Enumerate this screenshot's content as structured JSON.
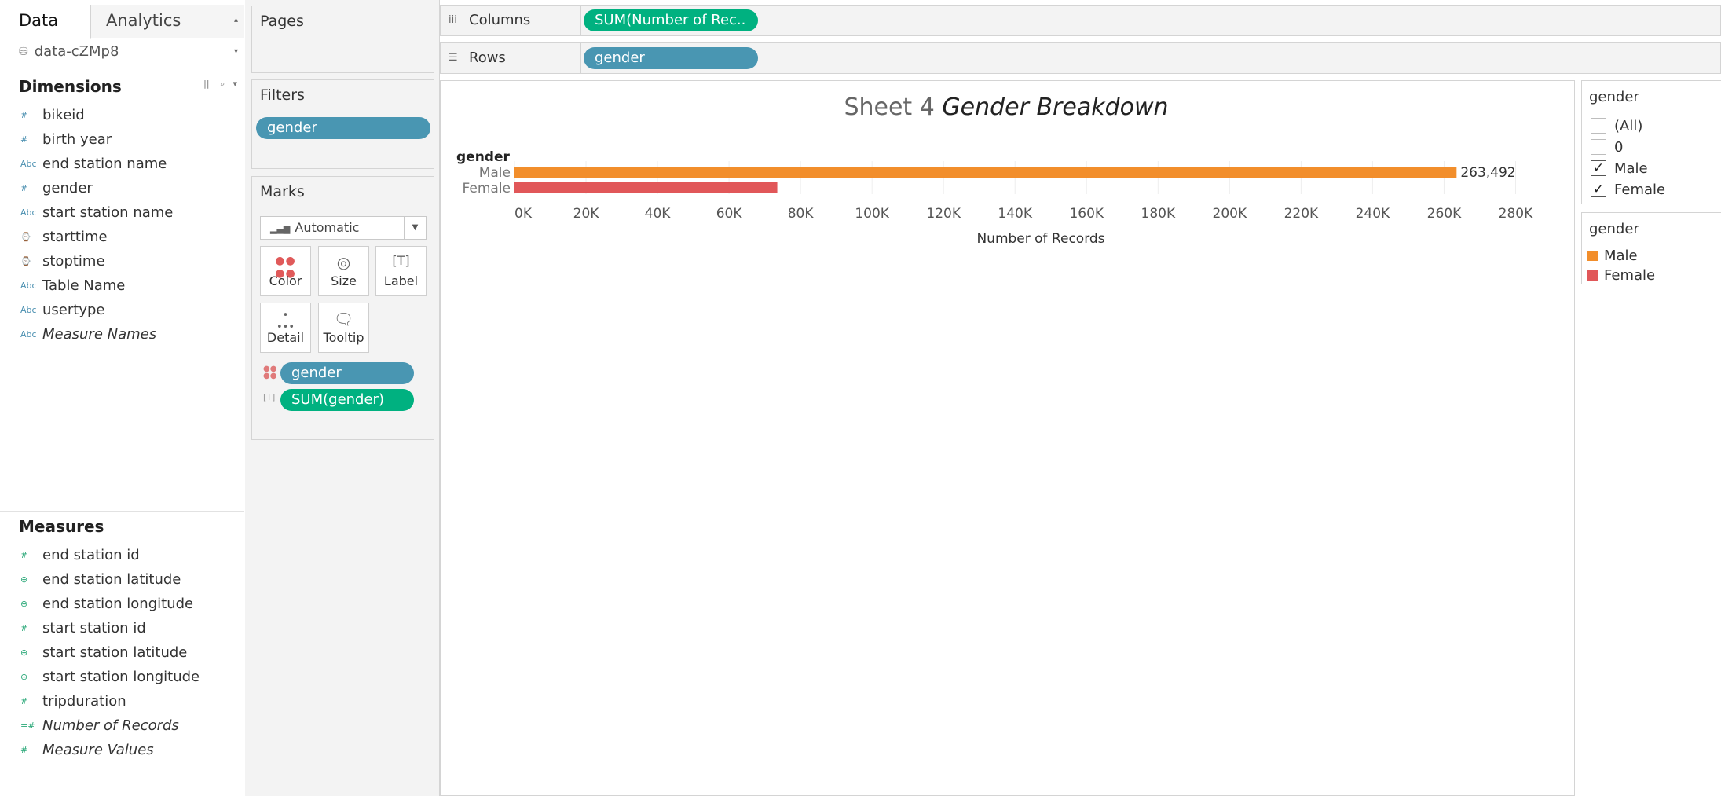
{
  "left_pane": {
    "tabs": [
      {
        "label": "Data"
      },
      {
        "label": "Analytics"
      }
    ],
    "datasource": "data-cZMp8",
    "dimensions_header": "Dimensions",
    "dimensions": [
      {
        "label": "bikeid",
        "icon": "#"
      },
      {
        "label": "birth year",
        "icon": "#"
      },
      {
        "label": "end station name",
        "icon": "Abc"
      },
      {
        "label": "gender",
        "icon": "#"
      },
      {
        "label": "start station name",
        "icon": "Abc"
      },
      {
        "label": "starttime",
        "icon": "date-time-icon"
      },
      {
        "label": "stoptime",
        "icon": "date-time-icon"
      },
      {
        "label": "Table Name",
        "icon": "Abc"
      },
      {
        "label": "usertype",
        "icon": "Abc"
      },
      {
        "label": "Measure Names",
        "icon": "Abc"
      }
    ],
    "measures_header": "Measures",
    "measures": [
      {
        "label": "end station id",
        "icon": "#"
      },
      {
        "label": "end station latitude",
        "icon": "globe-icon"
      },
      {
        "label": "end station longitude",
        "icon": "globe-icon"
      },
      {
        "label": "start station id",
        "icon": "#"
      },
      {
        "label": "start station latitude",
        "icon": "globe-icon"
      },
      {
        "label": "start station longitude",
        "icon": "globe-icon"
      },
      {
        "label": "tripduration",
        "icon": "#"
      },
      {
        "label": "Number of Records",
        "icon": "=#"
      },
      {
        "label": "Measure Values",
        "icon": "#"
      }
    ]
  },
  "cards": {
    "pages_title": "Pages",
    "filters_title": "Filters",
    "filter_pill": "gender",
    "marks_title": "Marks",
    "mark_type": "Automatic",
    "mark_buttons": {
      "color": "Color",
      "size": "Size",
      "label": "Label",
      "detail": "Detail",
      "tooltip": "Tooltip"
    },
    "mark_pills": {
      "color_pill": "gender",
      "label_pill": "SUM(gender)"
    }
  },
  "shelves": {
    "columns_label": "Columns",
    "columns_pill": "SUM(Number of Rec..",
    "rows_label": "Rows",
    "rows_pill": "gender"
  },
  "chart_data": {
    "type": "bar",
    "title": "Sheet 4",
    "title_italic": "Gender Breakdown",
    "ylabel": "gender",
    "xlabel": "Number of Records",
    "categories": [
      "Male",
      "Female"
    ],
    "values": [
      263492,
      73500
    ],
    "value_labels": [
      "263,492",
      ""
    ],
    "colors": [
      "#f28e2b",
      "#e15759"
    ],
    "xlim": [
      0,
      290000
    ],
    "ticks": [
      0,
      20000,
      40000,
      60000,
      80000,
      100000,
      120000,
      140000,
      160000,
      180000,
      200000,
      220000,
      240000,
      260000,
      280000
    ],
    "tick_labels": [
      "0K",
      "20K",
      "40K",
      "60K",
      "80K",
      "100K",
      "120K",
      "140K",
      "160K",
      "180K",
      "200K",
      "220K",
      "240K",
      "260K",
      "280K"
    ],
    "grid": true
  },
  "filter_card": {
    "title": "gender",
    "items": [
      {
        "label": "(All)",
        "checked": false
      },
      {
        "label": "0",
        "checked": false
      },
      {
        "label": "Male",
        "checked": true
      },
      {
        "label": "Female",
        "checked": true
      }
    ],
    "check_glyph": "✓"
  },
  "legend_card": {
    "title": "gender",
    "items": [
      {
        "label": "Male",
        "color": "#f28e2b"
      },
      {
        "label": "Female",
        "color": "#e15759"
      }
    ]
  }
}
